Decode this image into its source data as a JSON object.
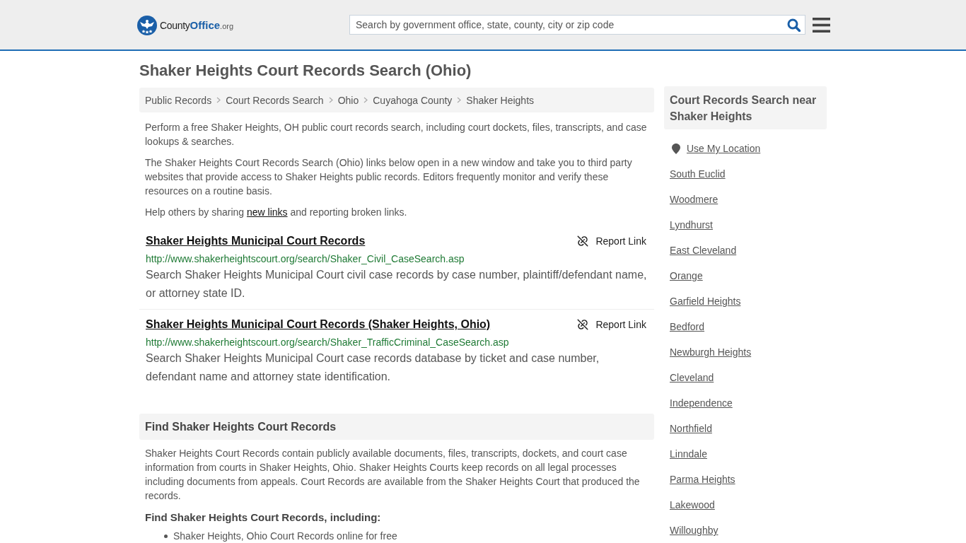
{
  "header": {
    "logo": [
      {
        "kind": "plain",
        "text": "County"
      },
      {
        "kind": "strong",
        "text": "Office"
      },
      {
        "kind": "small",
        "text": ".org"
      }
    ],
    "search": {
      "placeholder": "Search by government office, state, county, city or zip code"
    }
  },
  "page_title": "Shaker Heights Court Records Search (Ohio)",
  "breadcrumbs": [
    "Public Records",
    "Court Records Search",
    "Ohio",
    "Cuyahoga County",
    "Shaker Heights"
  ],
  "intro": [
    "Perform a free Shaker Heights, OH public court records search, including court dockets, files, transcripts, and case lookups & searches.",
    "The Shaker Heights Court Records Search (Ohio) links below open in a new window and take you to third party websites that provide access to Shaker Heights public records. Editors frequently monitor and verify these resources on a routine basis."
  ],
  "share_note": {
    "before": "Help others by sharing",
    "link": "new links",
    "after": "and reporting broken links."
  },
  "links": [
    {
      "title": "Shaker Heights Municipal Court Records",
      "url": "http://www.shakerheightscourt.org/search/Shaker_Civil_CaseSearch.asp",
      "description": "Search Shaker Heights Municipal Court civil case records by case number, plaintiff/defendant name, or attorney state ID.",
      "report_label": "Report Link"
    },
    {
      "title": "Shaker Heights Municipal Court Records (Shaker Heights, Ohio)",
      "url": "http://www.shakerheightscourt.org/search/Shaker_TrafficCriminal_CaseSearch.asp",
      "description": "Search Shaker Heights Municipal Court case records database by ticket and case number, defendant name and attorney state identification.",
      "report_label": "Report Link"
    }
  ],
  "find_section": {
    "heading": "Find Shaker Heights Court Records",
    "body": "Shaker Heights Court Records contain publicly available documents, files, transcripts, dockets, and court case information from courts in Shaker Heights, Ohio. Shaker Heights Courts keep records on all legal processes including documents from appeals. Court Records are available from the Shaker Heights Court that produced the records.",
    "subheading": "Find Shaker Heights Court Records, including:",
    "items": [
      "Shaker Heights, Ohio Court Records online for free"
    ]
  },
  "sidebar": {
    "heading": "Court Records Search near Shaker Heights",
    "location_link": "Use My Location",
    "places": [
      "South Euclid",
      "Woodmere",
      "Lyndhurst",
      "East Cleveland",
      "Orange",
      "Garfield Heights",
      "Bedford",
      "Newburgh Heights",
      "Cleveland",
      "Independence",
      "Northfield",
      "Linndale",
      "Parma Heights",
      "Lakewood",
      "Willoughby"
    ]
  }
}
